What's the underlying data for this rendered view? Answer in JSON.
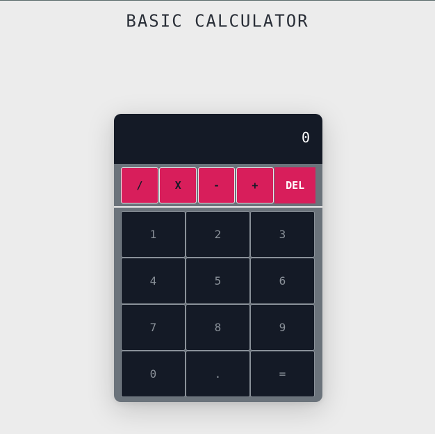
{
  "page": {
    "title": "BASIC CALCULATOR"
  },
  "display": {
    "value": "0"
  },
  "operators": [
    {
      "label": "/"
    },
    {
      "label": "X"
    },
    {
      "label": "-"
    },
    {
      "label": "+"
    },
    {
      "label": "DEL"
    }
  ],
  "keys": [
    {
      "label": "1"
    },
    {
      "label": "2"
    },
    {
      "label": "3"
    },
    {
      "label": "4"
    },
    {
      "label": "5"
    },
    {
      "label": "6"
    },
    {
      "label": "7"
    },
    {
      "label": "8"
    },
    {
      "label": "9"
    },
    {
      "label": "0"
    },
    {
      "label": "."
    },
    {
      "label": "="
    }
  ],
  "colors": {
    "background": "#ececec",
    "panel": "#6b737b",
    "display": "#141a26",
    "operator": "#d81e5b",
    "key": "#141a26",
    "key_text": "#8a9199"
  }
}
